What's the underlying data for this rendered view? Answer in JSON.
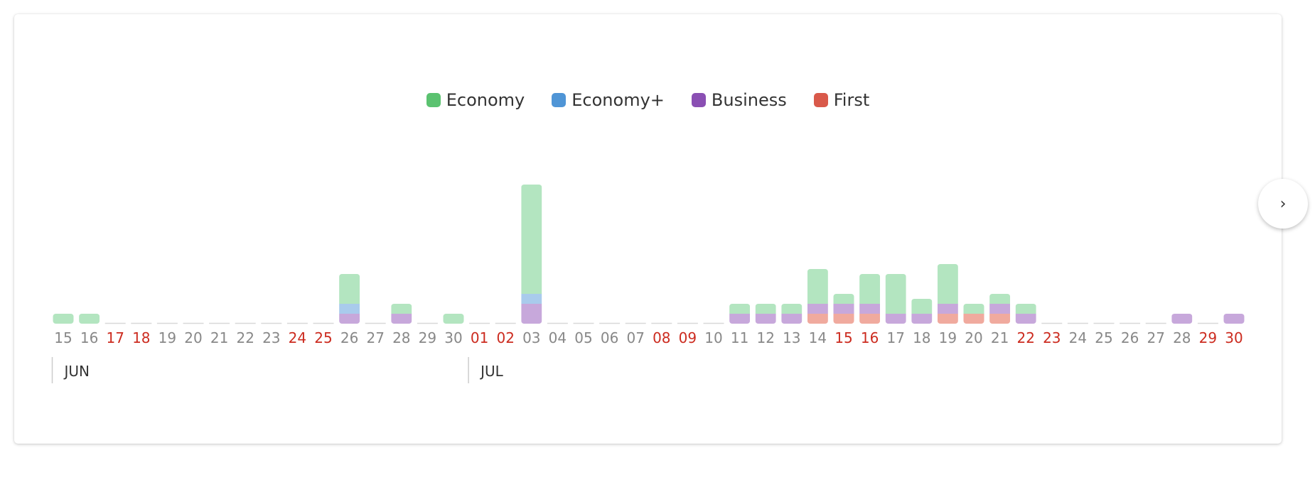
{
  "colors": {
    "economy": "#b3e5c0",
    "economy_plus": "#a9cbec",
    "business": "#c7a8db",
    "first": "#f0aa9e",
    "legend_economy": "#5bc270",
    "legend_economy_plus": "#4f95d6",
    "legend_business": "#8a4fb3",
    "legend_first": "#d9594a",
    "weekend_label": "#cc2b1f",
    "weekday_label": "#888888"
  },
  "navigation": {
    "next_icon": "chevron-right-icon",
    "next_glyph": "›"
  },
  "chart_data": {
    "type": "bar",
    "stacked": true,
    "legend": [
      "Economy",
      "Economy+",
      "Business",
      "First"
    ],
    "legend_placement": "top-center",
    "grid": false,
    "y_axis_visible": false,
    "units": "seats",
    "months": [
      {
        "label": "JUN",
        "start_index": 0
      },
      {
        "label": "JUL",
        "start_index": 16
      }
    ],
    "categories": [
      "15",
      "16",
      "17",
      "18",
      "19",
      "20",
      "21",
      "22",
      "23",
      "24",
      "25",
      "26",
      "27",
      "28",
      "29",
      "30",
      "01",
      "02",
      "03",
      "04",
      "05",
      "06",
      "07",
      "08",
      "09",
      "10",
      "11",
      "12",
      "13",
      "14",
      "15",
      "16",
      "17",
      "18",
      "19",
      "20",
      "21",
      "22",
      "23",
      "24",
      "25",
      "26",
      "27",
      "28",
      "29",
      "30"
    ],
    "weekend": [
      false,
      false,
      true,
      true,
      false,
      false,
      false,
      false,
      false,
      true,
      true,
      false,
      false,
      false,
      false,
      false,
      true,
      true,
      false,
      false,
      false,
      false,
      false,
      true,
      true,
      false,
      false,
      false,
      false,
      false,
      true,
      true,
      false,
      false,
      false,
      false,
      false,
      true,
      true,
      false,
      false,
      false,
      false,
      false,
      true,
      true
    ],
    "series": [
      {
        "name": "Economy",
        "values": [
          1,
          1,
          0,
          0,
          0,
          0,
          0,
          0,
          0,
          0,
          0,
          3,
          0,
          1,
          0,
          1,
          0,
          0,
          11,
          0,
          0,
          0,
          0,
          0,
          0,
          0,
          1,
          1,
          1,
          3.5,
          1,
          3,
          4,
          1.5,
          4,
          1,
          1,
          1,
          0,
          0,
          0,
          0,
          0,
          0,
          0,
          0
        ]
      },
      {
        "name": "Economy+",
        "values": [
          0,
          0,
          0,
          0,
          0,
          0,
          0,
          0,
          0,
          0,
          0,
          1,
          0,
          0,
          0,
          0,
          0,
          0,
          1,
          0,
          0,
          0,
          0,
          0,
          0,
          0,
          0,
          0,
          0,
          0,
          0,
          0,
          0,
          0,
          0,
          0,
          0,
          0,
          0,
          0,
          0,
          0,
          0,
          0,
          0,
          0
        ]
      },
      {
        "name": "Business",
        "values": [
          0,
          0,
          0,
          0,
          0,
          0,
          0,
          0,
          0,
          0,
          0,
          1,
          0,
          1,
          0,
          0,
          0,
          0,
          2,
          0,
          0,
          0,
          0,
          0,
          0,
          0,
          1,
          1,
          1,
          1,
          1,
          1,
          1,
          1,
          1,
          0,
          1,
          1,
          0,
          0,
          0,
          0,
          0,
          1,
          0,
          1
        ]
      },
      {
        "name": "First",
        "values": [
          0,
          0,
          0,
          0,
          0,
          0,
          0,
          0,
          0,
          0,
          0,
          0,
          0,
          0,
          0,
          0,
          0,
          0,
          0,
          0,
          0,
          0,
          0,
          0,
          0,
          0,
          0,
          0,
          0,
          1,
          1,
          1,
          0,
          0,
          1,
          1,
          1,
          0,
          0,
          0,
          0,
          0,
          0,
          0,
          0,
          0
        ]
      }
    ]
  }
}
